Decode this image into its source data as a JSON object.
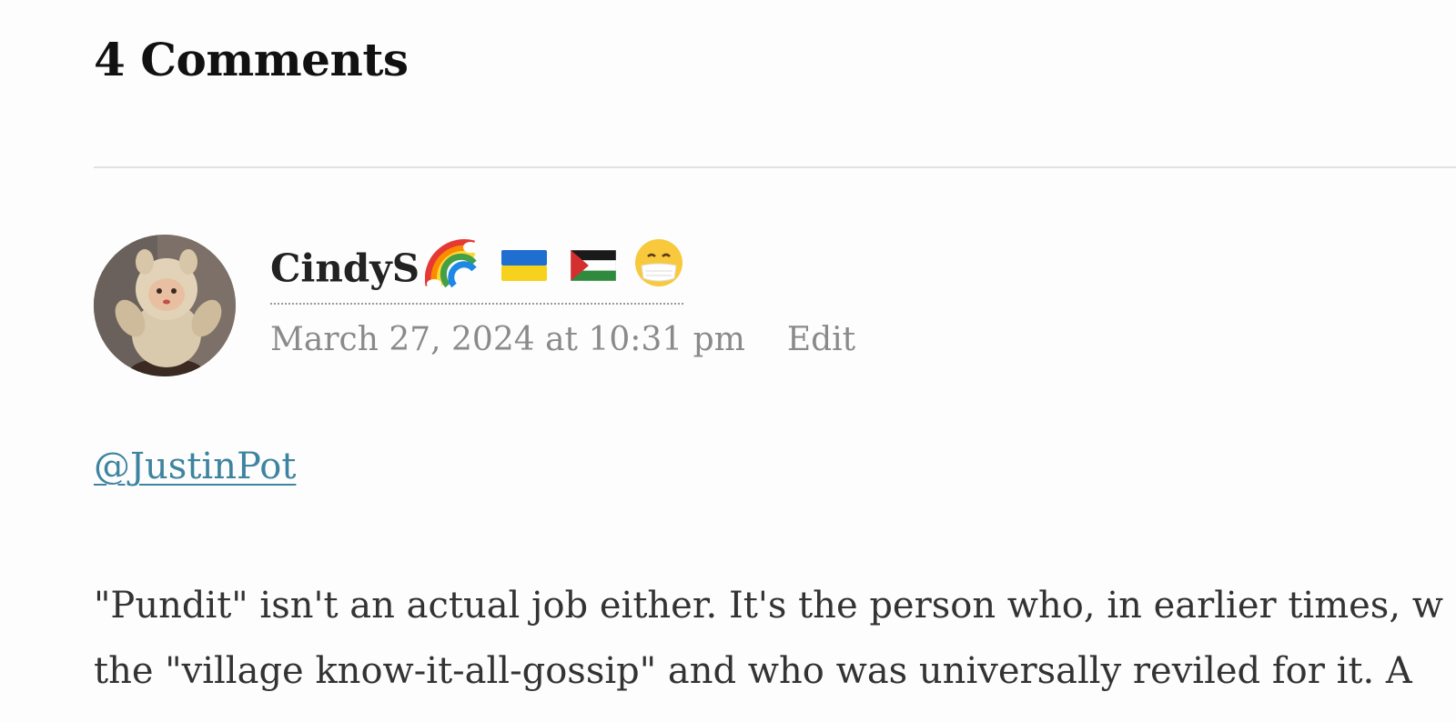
{
  "comments_section": {
    "heading": "4 Comments"
  },
  "comment": {
    "author": "CindyS",
    "author_emojis": [
      "rainbow-icon",
      "ukraine-flag-icon",
      "palestine-flag-icon",
      "face-with-medical-mask-icon"
    ],
    "timestamp": "March 27, 2024 at 10:31 pm",
    "edit_label": "Edit",
    "mention": "@JustinPot",
    "body_lines": [
      "\"Pundit\" isn't an actual job either. It's the person who, in earlier times, w",
      "the \"village know-it-all-gossip\" and who was universally reviled for it. A"
    ],
    "avatar": "avatar-teddy-doll"
  },
  "colors": {
    "link": "#3e84a0",
    "meta": "#8a8a8a",
    "heading": "#111111",
    "divider": "#e2e2e2"
  }
}
